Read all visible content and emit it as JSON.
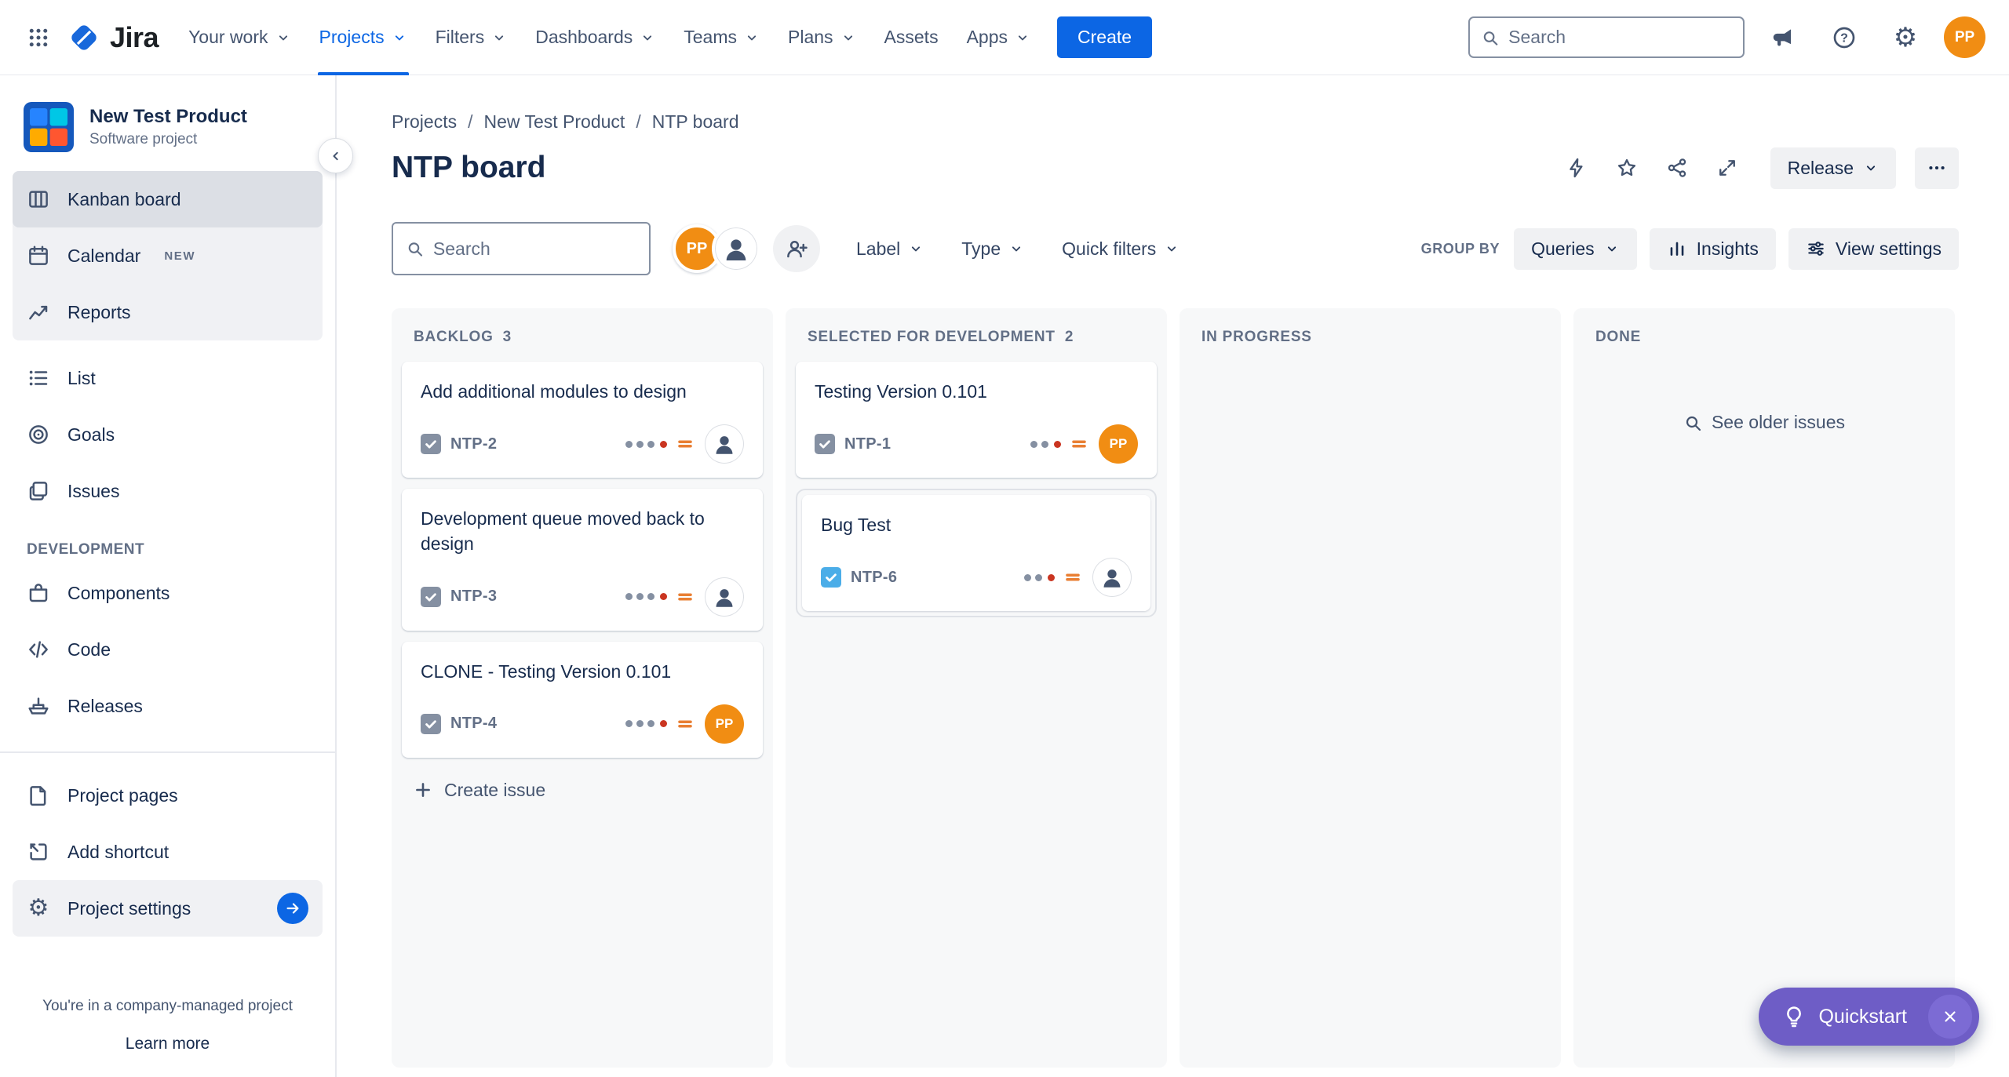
{
  "colors": {
    "accent_blue": "#0C66E4",
    "quickstart_purple": "#6E5DC6",
    "avatar_orange": "#F18D13",
    "priority_medium_orange": "#E97F33",
    "status_dot_red": "#CA3521",
    "issue_type_gray": "#8590A2",
    "issue_type_blue": "#4BADE8",
    "column_bg": "#F7F8F9",
    "selected_nav_bg": "#DCDFE5"
  },
  "topnav": {
    "logo_text": "Jira",
    "items": [
      {
        "label": "Your work"
      },
      {
        "label": "Projects"
      },
      {
        "label": "Filters"
      },
      {
        "label": "Dashboards"
      },
      {
        "label": "Teams"
      },
      {
        "label": "Plans"
      },
      {
        "label": "Assets"
      },
      {
        "label": "Apps"
      }
    ],
    "create_label": "Create",
    "search_placeholder": "Search",
    "user_initials": "PP"
  },
  "sidebar": {
    "project_name": "New Test Product",
    "project_type": "Software project",
    "nav": [
      {
        "label": "Kanban board"
      },
      {
        "label": "Calendar",
        "badge": "NEW"
      },
      {
        "label": "Reports"
      }
    ],
    "views": [
      {
        "label": "List"
      },
      {
        "label": "Goals"
      },
      {
        "label": "Issues"
      }
    ],
    "development_section": "DEVELOPMENT",
    "development": [
      {
        "label": "Components"
      },
      {
        "label": "Code"
      },
      {
        "label": "Releases"
      }
    ],
    "shortcuts": [
      {
        "label": "Project pages"
      },
      {
        "label": "Add shortcut"
      }
    ],
    "settings_label": "Project settings",
    "footer_note": "You're in a company-managed project",
    "learn_more": "Learn more"
  },
  "header": {
    "breadcrumbs": [
      {
        "label": "Projects"
      },
      {
        "label": "New Test Product"
      },
      {
        "label": "NTP board"
      }
    ],
    "title": "NTP board",
    "release_label": "Release"
  },
  "toolbar": {
    "search_placeholder": "Search",
    "avatar_initials": "PP",
    "filters": [
      {
        "label": "Label"
      },
      {
        "label": "Type"
      },
      {
        "label": "Quick filters"
      }
    ],
    "group_by_label": "GROUP BY",
    "group_by_value": "Queries",
    "insights_label": "Insights",
    "view_settings_label": "View settings"
  },
  "board": {
    "create_issue_label": "Create issue",
    "columns": [
      {
        "title": "BACKLOG",
        "count": "3",
        "cards": [
          {
            "title": "Add additional modules to design",
            "key": "NTP-2"
          },
          {
            "title": "Development queue moved back to design",
            "key": "NTP-3"
          },
          {
            "title": "CLONE - Testing Version 0.101",
            "key": "NTP-4",
            "assignee": "PP"
          }
        ]
      },
      {
        "title": "SELECTED FOR DEVELOPMENT",
        "count": "2",
        "cards": [
          {
            "title": "Testing Version 0.101",
            "key": "NTP-1",
            "assignee": "PP"
          },
          {
            "title": "Bug Test",
            "key": "NTP-6"
          }
        ]
      },
      {
        "title": "IN PROGRESS",
        "cards": []
      },
      {
        "title": "DONE",
        "see_older_label": "See older issues",
        "cards": []
      }
    ]
  },
  "quickstart": {
    "label": "Quickstart"
  }
}
